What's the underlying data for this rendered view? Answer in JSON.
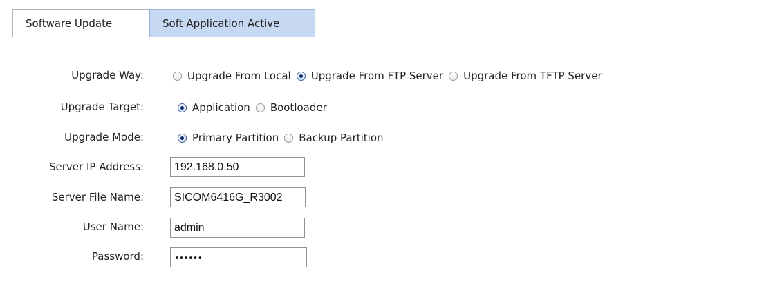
{
  "tabs": [
    {
      "label": "Software Update",
      "active": true
    },
    {
      "label": "Soft Application Active",
      "active": false
    }
  ],
  "form": {
    "upgrade_way": {
      "label": "Upgrade Way:",
      "options": [
        {
          "label": "Upgrade From Local",
          "checked": false
        },
        {
          "label": "Upgrade From FTP Server",
          "checked": true
        },
        {
          "label": "Upgrade From TFTP Server",
          "checked": false
        }
      ]
    },
    "upgrade_target": {
      "label": "Upgrade Target:",
      "options": [
        {
          "label": "Application",
          "checked": true
        },
        {
          "label": "Bootloader",
          "checked": false
        }
      ]
    },
    "upgrade_mode": {
      "label": "Upgrade Mode:",
      "options": [
        {
          "label": "Primary Partition",
          "checked": true
        },
        {
          "label": "Backup Partition",
          "checked": false
        }
      ]
    },
    "server_ip": {
      "label": "Server IP Address:",
      "value": "192.168.0.50"
    },
    "server_file": {
      "label": "Server File Name:",
      "value": "SICOM6416G_R3002"
    },
    "user_name": {
      "label": "User Name:",
      "value": "admin"
    },
    "password": {
      "label": "Password:",
      "value": "••••••"
    }
  },
  "colors": {
    "inactive_tab": "#c6d8f2",
    "border": "#b9bec5"
  }
}
